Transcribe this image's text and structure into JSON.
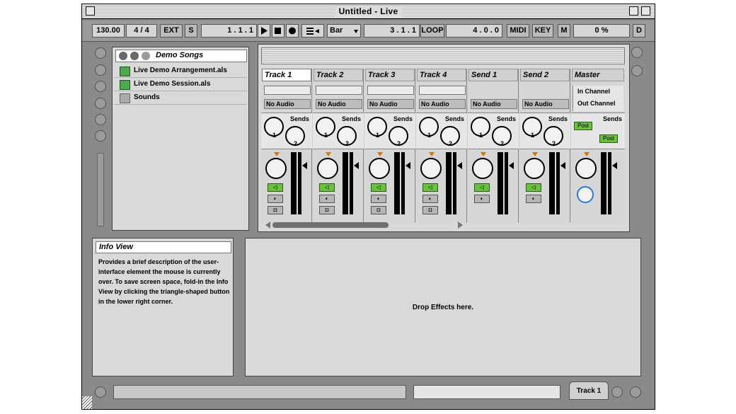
{
  "window": {
    "title": "Untitled - Live"
  },
  "transport": {
    "tempo": "130.00",
    "signature": "4 / 4",
    "ext": "EXT",
    "s": "S",
    "position": "1 .  1 .  1",
    "quantize": "Bar",
    "loop_start": "3 .  1 .  1",
    "loop": "LOOP",
    "loop_length": "4 .  0 .  0",
    "midi": "MIDI",
    "key": "KEY",
    "m": "M",
    "cpu": "0 %",
    "d": "D"
  },
  "browser": {
    "header": "Demo Songs",
    "items": [
      {
        "label": "Live Demo Arrangement.als",
        "icon": "live-set-icon"
      },
      {
        "label": "Live Demo Session.als",
        "icon": "live-set-icon"
      },
      {
        "label": "Sounds",
        "icon": "folder-icon"
      }
    ]
  },
  "mixer": {
    "sends_label": "Sends",
    "tracks": [
      {
        "name": "Track 1",
        "input": "No Audio"
      },
      {
        "name": "Track 2",
        "input": "No Audio"
      },
      {
        "name": "Track 3",
        "input": "No Audio"
      },
      {
        "name": "Track 4",
        "input": "No Audio"
      },
      {
        "name": "Send 1",
        "input": "No Audio"
      },
      {
        "name": "Send 2",
        "input": "No Audio"
      }
    ],
    "master": {
      "name": "Master",
      "in_channel": "In Channel",
      "out_channel": "Out Channel",
      "post1": "Post",
      "post2": "Post"
    },
    "knob_labels": [
      "1",
      "2"
    ]
  },
  "info": {
    "title": "Info View",
    "text": "Provides a brief description of the user-interface element the mouse is currently over. To save screen space, fold-in the Info View by clicking the triangle-shaped button in the lower right corner."
  },
  "device": {
    "drop_text": "Drop Effects here."
  },
  "status": {
    "track_tab": "Track 1"
  },
  "colors": {
    "window_bg": "#8a8a8a",
    "panel_bg": "#d9d9d9",
    "accent_green": "#6dbf3f",
    "accent_orange": "#e07000"
  }
}
